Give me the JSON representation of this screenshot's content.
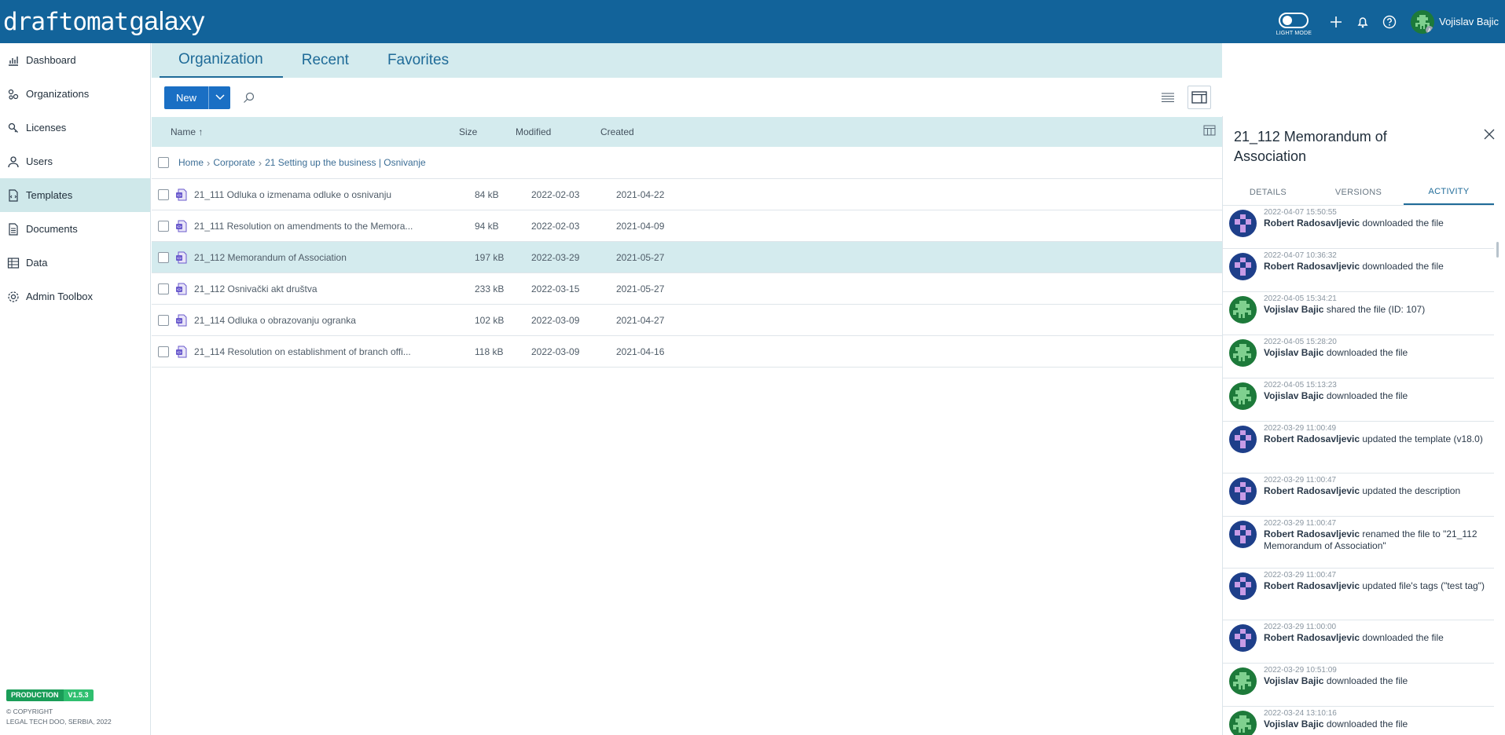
{
  "app": {
    "logo_part1": "draftomat",
    "logo_part2": "galaxy",
    "light_mode_label": "LIGHT MODE",
    "user_name": "Vojislav Bajic",
    "icons": [
      "plus-icon",
      "bell-icon",
      "help-icon"
    ]
  },
  "sidebar": {
    "items": [
      {
        "label": "Dashboard",
        "icon": "chart-icon"
      },
      {
        "label": "Organizations",
        "icon": "organizations-icon"
      },
      {
        "label": "Licenses",
        "icon": "key-icon"
      },
      {
        "label": "Users",
        "icon": "user-icon"
      },
      {
        "label": "Templates",
        "icon": "template-icon",
        "active": true
      },
      {
        "label": "Documents",
        "icon": "document-icon"
      },
      {
        "label": "Data",
        "icon": "table-icon"
      },
      {
        "label": "Admin Toolbox",
        "icon": "gear-icon"
      }
    ],
    "env_badge": "PRODUCTION",
    "version_badge": "V1.5.3",
    "copyright_line1": "© COPYRIGHT",
    "copyright_line2": "LEGAL TECH DOO, SERBIA, 2022"
  },
  "tabs": [
    {
      "label": "Organization",
      "active": true
    },
    {
      "label": "Recent"
    },
    {
      "label": "Favorites"
    }
  ],
  "toolbar": {
    "new_label": "New"
  },
  "table": {
    "headers": {
      "name": "Name",
      "size": "Size",
      "modified": "Modified",
      "created": "Created"
    },
    "breadcrumb": [
      "Home",
      "Corporate",
      "21 Setting up the business | Osnivanje"
    ],
    "rows": [
      {
        "name": "21_111 Odluka o izmenama odluke o osnivanju",
        "size": "84 kB",
        "modified": "2022-02-03",
        "created": "2021-04-22"
      },
      {
        "name": "21_111 Resolution on amendments to the Memora...",
        "size": "94 kB",
        "modified": "2022-02-03",
        "created": "2021-04-09"
      },
      {
        "name": "21_112 Memorandum of Association",
        "size": "197 kB",
        "modified": "2022-03-29",
        "created": "2021-05-27",
        "selected": true
      },
      {
        "name": "21_112 Osnivački akt društva",
        "size": "233 kB",
        "modified": "2022-03-15",
        "created": "2021-05-27"
      },
      {
        "name": "21_114 Odluka o obrazovanju ogranka",
        "size": "102 kB",
        "modified": "2022-03-09",
        "created": "2021-04-27"
      },
      {
        "name": "21_114 Resolution on establishment of branch offi...",
        "size": "118 kB",
        "modified": "2022-03-09",
        "created": "2021-04-16"
      }
    ]
  },
  "panel": {
    "title": "21_112 Memorandum of Association",
    "tabs": [
      "DETAILS",
      "VERSIONS",
      "ACTIVITY"
    ],
    "active_tab": "ACTIVITY",
    "activity": [
      {
        "ts": "2022-04-07 15:50:55",
        "who": "Robert Radosavljevic",
        "what": " downloaded the file",
        "avatar": "robert"
      },
      {
        "ts": "2022-04-07 10:36:32",
        "who": "Robert Radosavljevic",
        "what": " downloaded the file",
        "avatar": "robert"
      },
      {
        "ts": "2022-04-05 15:34:21",
        "who": "Vojislav Bajic",
        "what": " shared the file (ID: 107)",
        "avatar": "vojislav"
      },
      {
        "ts": "2022-04-05 15:28:20",
        "who": "Vojislav Bajic",
        "what": " downloaded the file",
        "avatar": "vojislav"
      },
      {
        "ts": "2022-04-05 15:13:23",
        "who": "Vojislav Bajic",
        "what": " downloaded the file",
        "avatar": "vojislav"
      },
      {
        "ts": "2022-03-29 11:00:49",
        "who": "Robert Radosavljevic",
        "what": " updated the template (v18.0)",
        "avatar": "robert",
        "tall": true
      },
      {
        "ts": "2022-03-29 11:00:47",
        "who": "Robert Radosavljevic",
        "what": " updated the description",
        "avatar": "robert"
      },
      {
        "ts": "2022-03-29 11:00:47",
        "who": "Robert Radosavljevic",
        "what": " renamed the file to \"21_112 Memorandum of Association\"",
        "avatar": "robert",
        "tall": true
      },
      {
        "ts": "2022-03-29 11:00:47",
        "who": "Robert Radosavljevic",
        "what": " updated file's tags (\"test tag\")",
        "avatar": "robert",
        "tall": true
      },
      {
        "ts": "2022-03-29 11:00:00",
        "who": "Robert Radosavljevic",
        "what": " downloaded the file",
        "avatar": "robert"
      },
      {
        "ts": "2022-03-29 10:51:09",
        "who": "Vojislav Bajic",
        "what": " downloaded the file",
        "avatar": "vojislav"
      },
      {
        "ts": "2022-03-24 13:10:16",
        "who": "Vojislav Bajic",
        "what": " downloaded the file",
        "avatar": "vojislav"
      }
    ]
  },
  "colors": {
    "brand": "#12639a",
    "tab_bg": "#d4ebee",
    "primary_button": "#1a6fc4",
    "production_badge": "#1a9d58"
  }
}
